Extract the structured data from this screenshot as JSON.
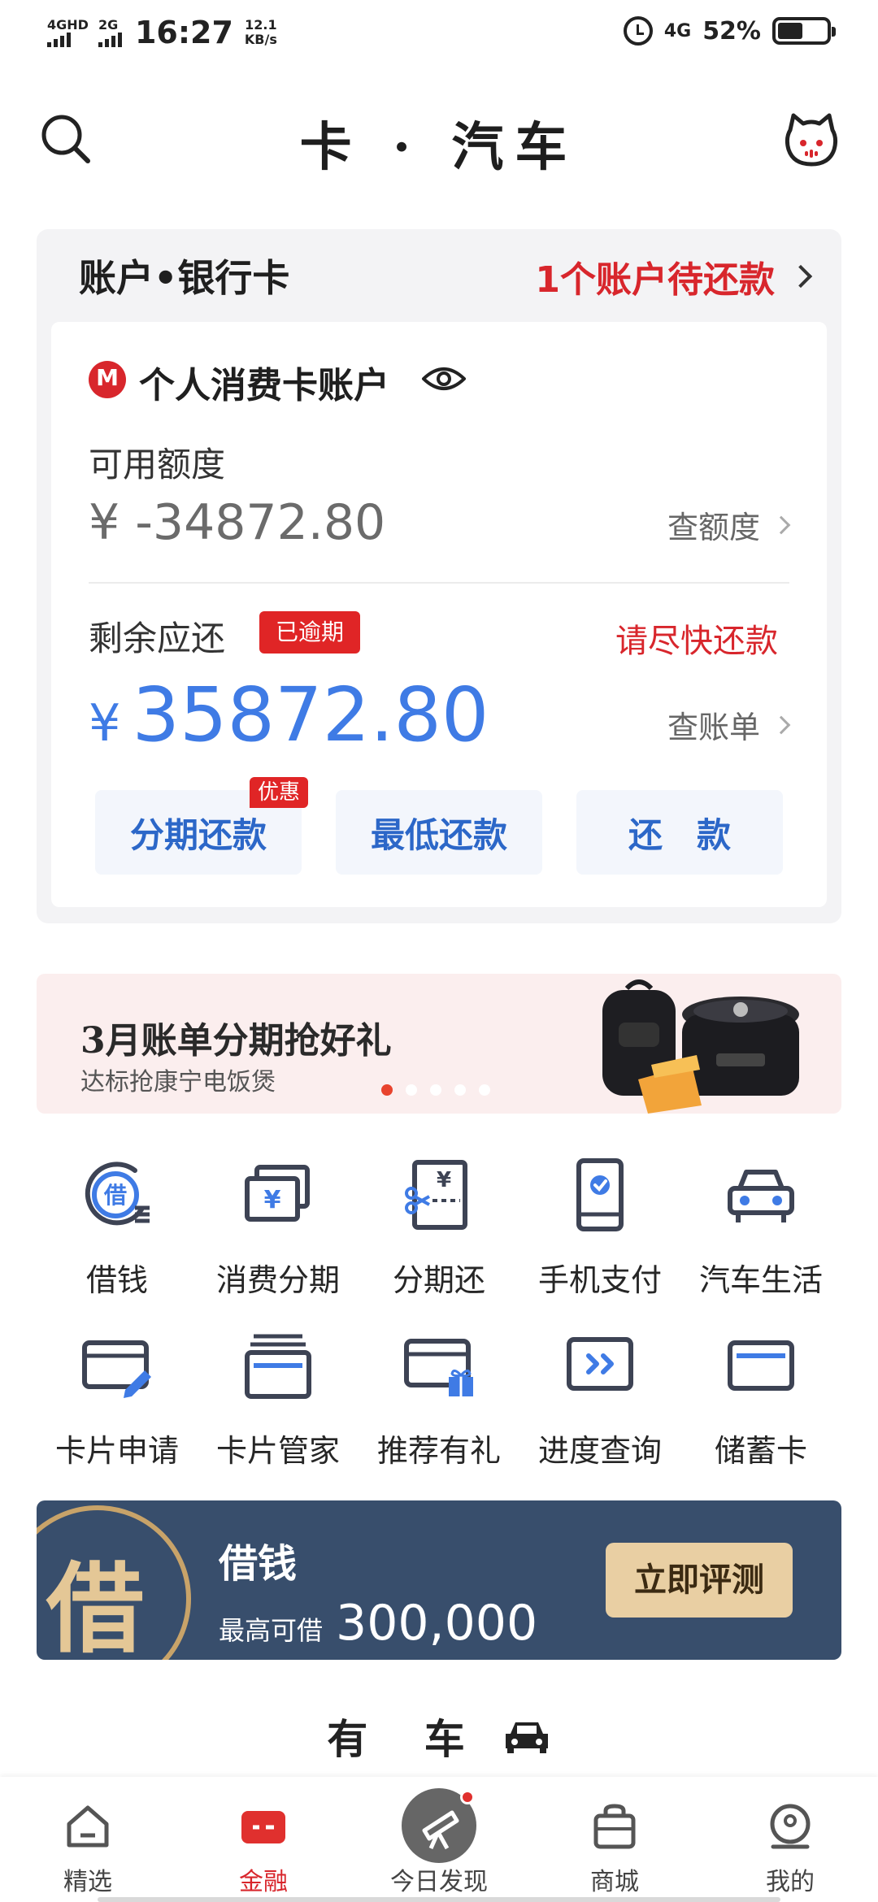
{
  "status_bar": {
    "network1": "4GHD",
    "network2": "2G",
    "time": "16:27",
    "speed_value": "12.1",
    "speed_unit": "KB/s",
    "network3": "4G",
    "battery_percent": "52%",
    "battery_level": 0.52
  },
  "header": {
    "title": "卡 · 汽车",
    "left_icon": "search-icon",
    "right_icon": "cat-mascot-icon"
  },
  "account": {
    "title": "账户•银行卡",
    "due_notice": "1个账户待还款",
    "card_name": "个人消费卡账户",
    "available_label": "可用额度",
    "available_amount": "¥ -34872.80",
    "check_quota": "查额度",
    "remaining_label": "剩余应还",
    "overdue_badge": "已逾期",
    "urge_text": "请尽快还款",
    "currency": "¥",
    "remaining_amount": "35872.80",
    "check_bill": "查账单",
    "buttons": [
      {
        "label": "分期还款",
        "tag": "优惠"
      },
      {
        "label": "最低还款"
      },
      {
        "label": "还　款"
      }
    ]
  },
  "promo": {
    "title": "3月账单分期抢好礼",
    "subtitle": "达标抢康宁电饭煲",
    "active_slide": 1,
    "slide_count": 5
  },
  "services": [
    {
      "label": "借钱",
      "icon": "loan-icon"
    },
    {
      "label": "消费分期",
      "icon": "installment-card-icon"
    },
    {
      "label": "分期还",
      "icon": "installment-repay-icon"
    },
    {
      "label": "手机支付",
      "icon": "phone-pay-icon"
    },
    {
      "label": "汽车生活",
      "icon": "car-icon"
    },
    {
      "label": "卡片申请",
      "icon": "card-apply-icon"
    },
    {
      "label": "卡片管家",
      "icon": "card-manager-icon"
    },
    {
      "label": "推荐有礼",
      "icon": "referral-gift-icon"
    },
    {
      "label": "进度查询",
      "icon": "progress-query-icon"
    },
    {
      "label": "储蓄卡",
      "icon": "debit-card-icon"
    }
  ],
  "loan_banner": {
    "seal_char": "借",
    "title": "借钱",
    "subtitle": "最高可借",
    "amount": "300,000",
    "button": "立即评测"
  },
  "section": {
    "title": "有 车"
  },
  "nav": [
    {
      "label": "精选",
      "icon": "home-icon"
    },
    {
      "label": "金融",
      "icon": "finance-icon"
    },
    {
      "label": "今日发现",
      "icon": "telescope-icon"
    },
    {
      "label": "商城",
      "icon": "shopping-bag-icon"
    },
    {
      "label": "我的",
      "icon": "profile-icon"
    }
  ],
  "colors": {
    "accent_red": "#d8262c",
    "accent_blue": "#3f7be5",
    "loan_bg": "#384e6c"
  }
}
